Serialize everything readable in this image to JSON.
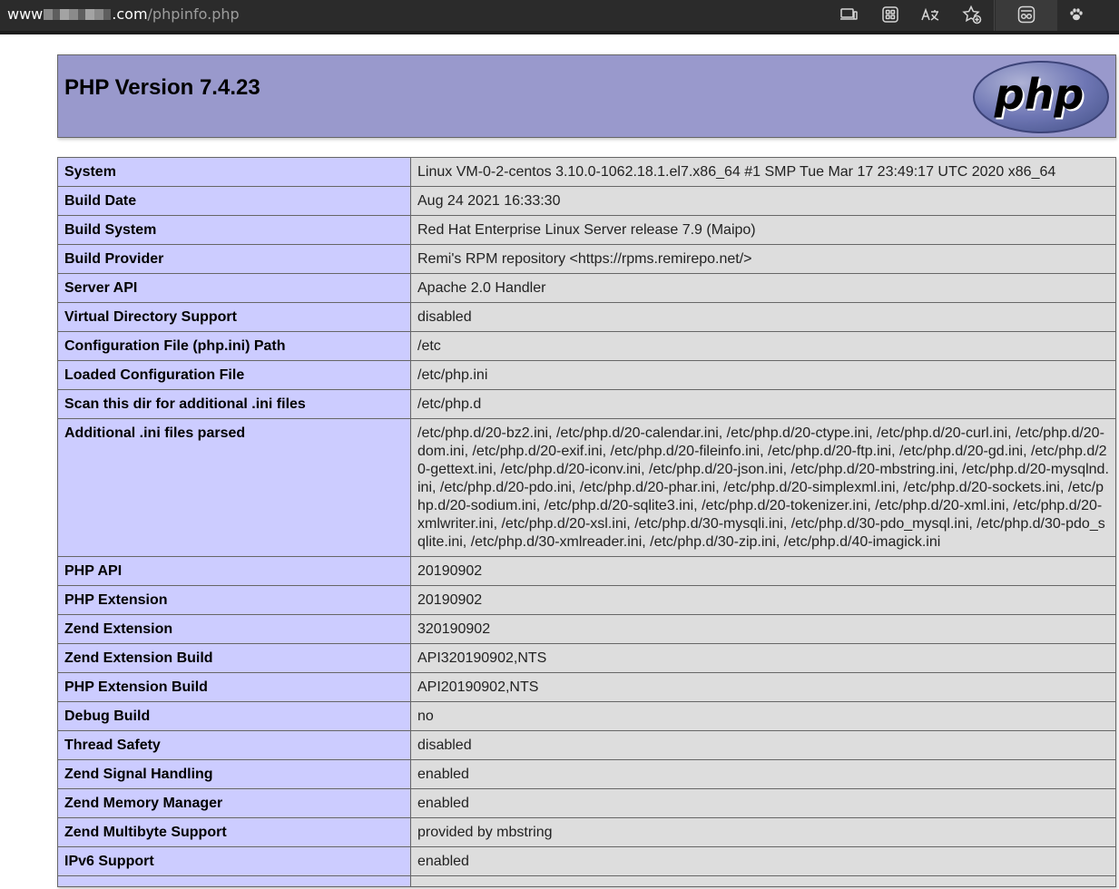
{
  "browser": {
    "url_host_prefix": "www",
    "url_host_suffix": ".com",
    "url_path": "/phpinfo.php",
    "toolbar_icons": [
      "devices-icon",
      "app-grid-icon",
      "translate-icon",
      "add-favorite-icon",
      "profile-icon",
      "extension-paw-icon"
    ]
  },
  "header": {
    "title": "PHP Version 7.4.23",
    "logo_text": "php"
  },
  "rows": [
    {
      "label": "System",
      "value": "Linux VM-0-2-centos 3.10.0-1062.18.1.el7.x86_64 #1 SMP Tue Mar 17 23:49:17 UTC 2020 x86_64"
    },
    {
      "label": "Build Date",
      "value": "Aug 24 2021 16:33:30"
    },
    {
      "label": "Build System",
      "value": "Red Hat Enterprise Linux Server release 7.9 (Maipo)"
    },
    {
      "label": "Build Provider",
      "value": "Remi's RPM repository <https://rpms.remirepo.net/>"
    },
    {
      "label": "Server API",
      "value": "Apache 2.0 Handler"
    },
    {
      "label": "Virtual Directory Support",
      "value": "disabled"
    },
    {
      "label": "Configuration File (php.ini) Path",
      "value": "/etc"
    },
    {
      "label": "Loaded Configuration File",
      "value": "/etc/php.ini"
    },
    {
      "label": "Scan this dir for additional .ini files",
      "value": "/etc/php.d"
    },
    {
      "label": "Additional .ini files parsed",
      "value": "/etc/php.d/20-bz2.ini, /etc/php.d/20-calendar.ini, /etc/php.d/20-ctype.ini, /etc/php.d/20-curl.ini, /etc/php.d/20-dom.ini, /etc/php.d/20-exif.ini, /etc/php.d/20-fileinfo.ini, /etc/php.d/20-ftp.ini, /etc/php.d/20-gd.ini, /etc/php.d/20-gettext.ini, /etc/php.d/20-iconv.ini, /etc/php.d/20-json.ini, /etc/php.d/20-mbstring.ini, /etc/php.d/20-mysqlnd.ini, /etc/php.d/20-pdo.ini, /etc/php.d/20-phar.ini, /etc/php.d/20-simplexml.ini, /etc/php.d/20-sockets.ini, /etc/php.d/20-sodium.ini, /etc/php.d/20-sqlite3.ini, /etc/php.d/20-tokenizer.ini, /etc/php.d/20-xml.ini, /etc/php.d/20-xmlwriter.ini, /etc/php.d/20-xsl.ini, /etc/php.d/30-mysqli.ini, /etc/php.d/30-pdo_mysql.ini, /etc/php.d/30-pdo_sqlite.ini, /etc/php.d/30-xmlreader.ini, /etc/php.d/30-zip.ini, /etc/php.d/40-imagick.ini"
    },
    {
      "label": "PHP API",
      "value": "20190902"
    },
    {
      "label": "PHP Extension",
      "value": "20190902"
    },
    {
      "label": "Zend Extension",
      "value": "320190902"
    },
    {
      "label": "Zend Extension Build",
      "value": "API320190902,NTS"
    },
    {
      "label": "PHP Extension Build",
      "value": "API20190902,NTS"
    },
    {
      "label": "Debug Build",
      "value": "no"
    },
    {
      "label": "Thread Safety",
      "value": "disabled"
    },
    {
      "label": "Zend Signal Handling",
      "value": "enabled"
    },
    {
      "label": "Zend Memory Manager",
      "value": "enabled"
    },
    {
      "label": "Zend Multibyte Support",
      "value": "provided by mbstring"
    },
    {
      "label": "IPv6 Support",
      "value": "enabled"
    },
    {
      "label": "",
      "value": ""
    }
  ]
}
